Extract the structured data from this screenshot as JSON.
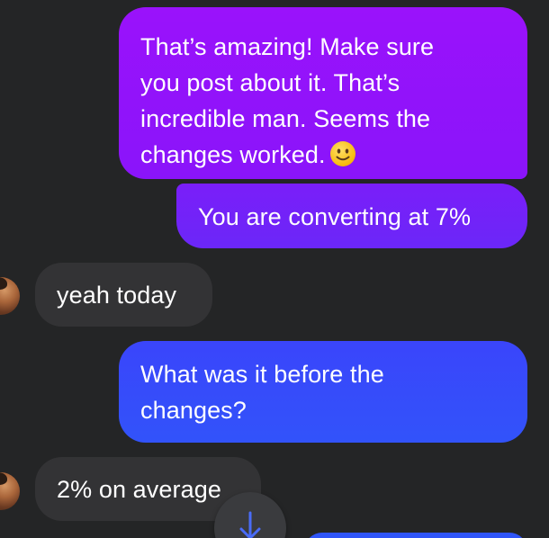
{
  "conversation": {
    "messages": [
      {
        "sender": "me",
        "lines": [
          "That’s amazing! Make sure",
          "you post about it. That’s",
          "incredible man. Seems the",
          "changes worked."
        ],
        "emoji": "slightly-smiling-face"
      },
      {
        "sender": "me",
        "text": "You are converting at 7%"
      },
      {
        "sender": "them",
        "text": "yeah today"
      },
      {
        "sender": "me",
        "lines": [
          "What was it before the",
          "changes?"
        ]
      },
      {
        "sender": "them",
        "text": "2% on average"
      }
    ]
  },
  "controls": {
    "scroll_down": {
      "icon": "arrow-down-icon"
    }
  },
  "colors": {
    "background": "#242526",
    "received_bubble": "#333335",
    "sent_gradient_top": "#9a12fb",
    "sent_gradient_bottom": "#2f55f8",
    "text": "#ffffff",
    "scroll_arrow": "#4a6cf7"
  }
}
